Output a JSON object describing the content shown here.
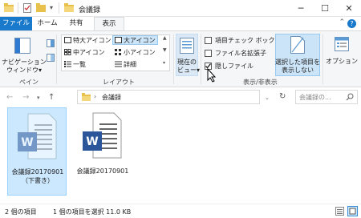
{
  "window": {
    "title": "会議録",
    "minimize_glyph": "─",
    "maximize_glyph": "☐",
    "close_glyph": "✕"
  },
  "tabs": [
    {
      "label": "ファイル"
    },
    {
      "label": "ホーム"
    },
    {
      "label": "共有"
    },
    {
      "label": "表示"
    }
  ],
  "help_glyph": "?",
  "ribbon": {
    "pane": {
      "nav_label_line1": "ナビゲーション",
      "nav_label_line2": "ウィンドウ▾",
      "group": "ペイン"
    },
    "layout": {
      "items": [
        "特大アイコン",
        "大アイコン",
        "中アイコン",
        "小アイコン",
        "一覧",
        "詳細"
      ],
      "group": "レイアウト"
    },
    "current_view": {
      "line1": "現在の",
      "line2": "ビュー▾"
    },
    "show_hide": {
      "item_checkbox": "項目チェック ボックス",
      "extensions": "ファイル名拡張子",
      "hidden": "隠しファイル",
      "hide_selected_line1": "選択した項目を",
      "hide_selected_line2": "表示しない",
      "group": "表示/非表示",
      "hidden_checked": true
    },
    "options": "オプション"
  },
  "address": {
    "path": "会議録",
    "search_placeholder": "会議録の..."
  },
  "files": [
    {
      "name_line1": "会議録20170901",
      "name_line2": "（下書き）",
      "selected": true
    },
    {
      "name_line1": "会議録20170901",
      "name_line2": "",
      "selected": false
    }
  ],
  "status": {
    "count": "2 個の項目",
    "selection": "1 個の項目を選択 11.0 KB"
  },
  "colors": {
    "accent": "#1979ca",
    "word_blue": "#2b579a",
    "selection": "#cce8ff"
  }
}
